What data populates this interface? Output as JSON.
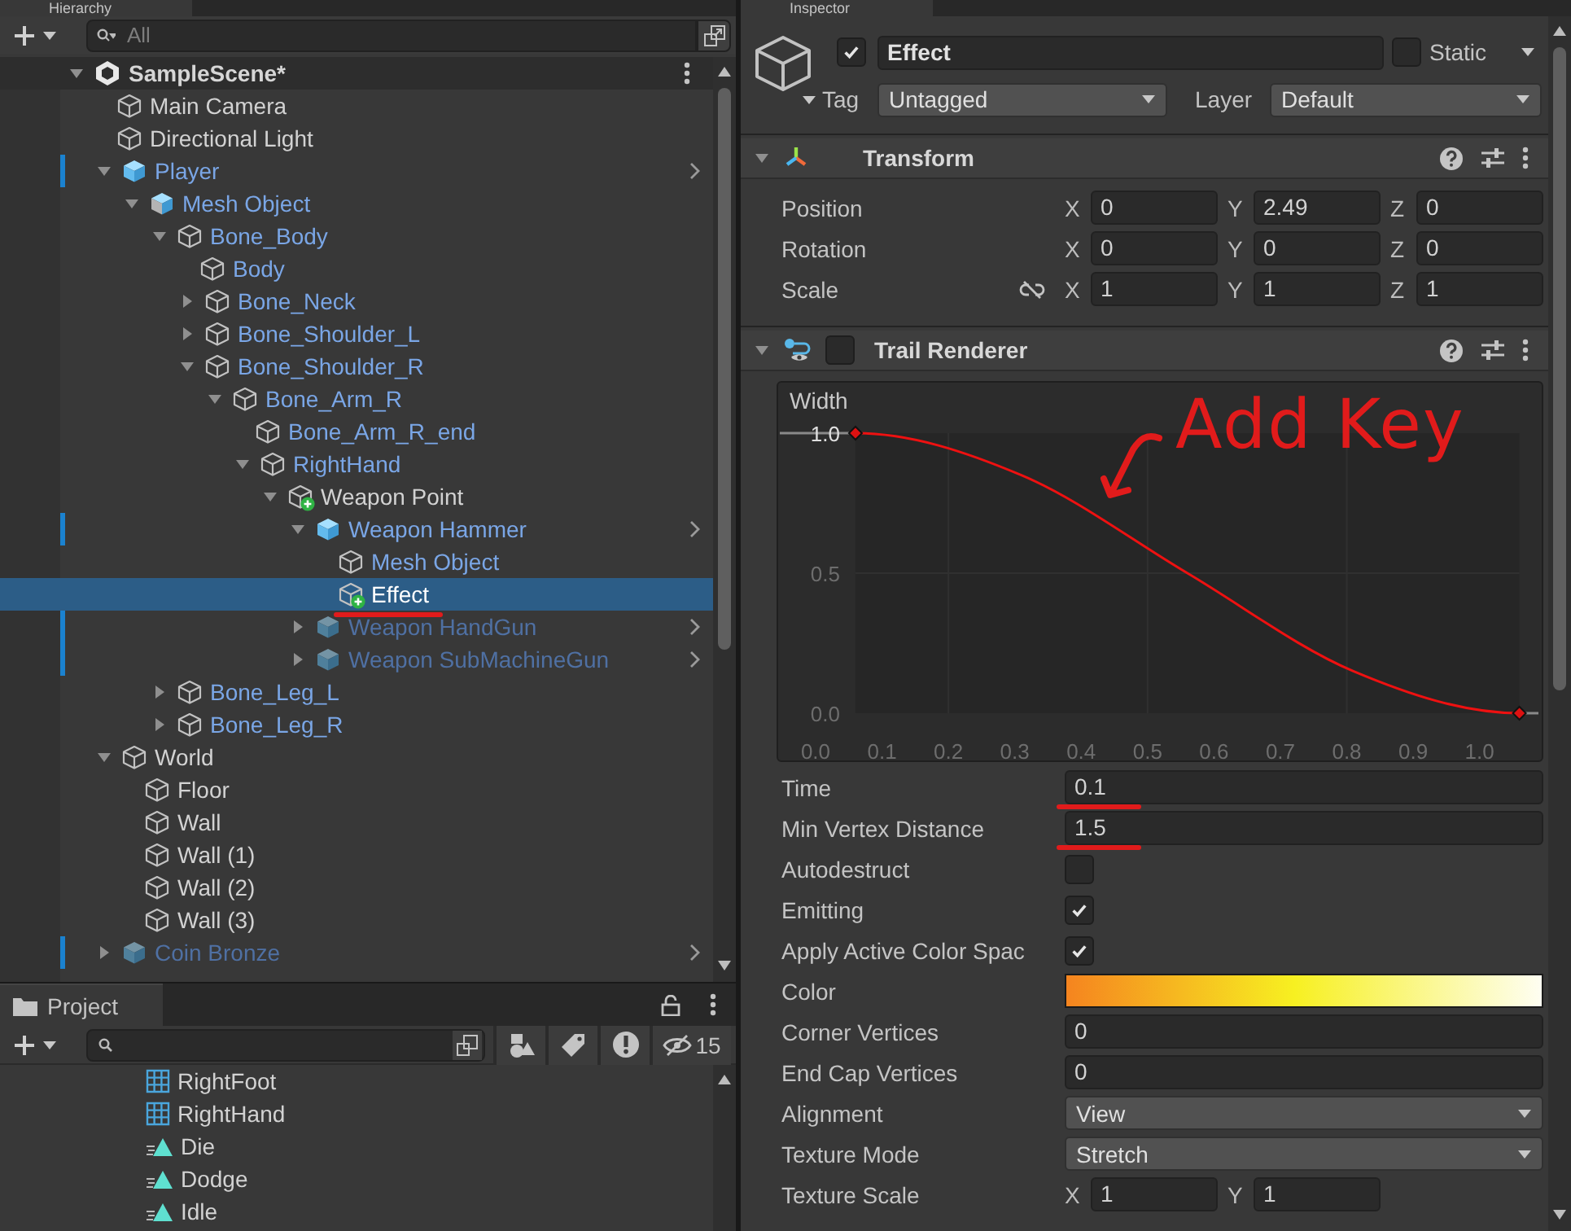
{
  "hierarchy": {
    "tab": "Hierarchy",
    "search": {
      "placeholder": "All"
    },
    "scene": {
      "name": "SampleScene*",
      "expanded": true
    },
    "items": [
      {
        "name": "Main Camera",
        "kind": "object",
        "added": false,
        "inactive": false,
        "selected": false,
        "marked": false
      },
      {
        "name": "Directional Light",
        "kind": "object",
        "added": false,
        "inactive": false,
        "selected": false,
        "marked": false
      },
      {
        "name": "Player",
        "kind": "prefab-root",
        "added": false,
        "inactive": false,
        "selected": false,
        "marked": false,
        "expanded": true,
        "children": [
          {
            "name": "Mesh Object",
            "kind": "model",
            "added": false,
            "inactive": false,
            "selected": false,
            "marked": false,
            "expanded": true,
            "children": [
              {
                "name": "Bone_Body",
                "kind": "prefab-child",
                "added": false,
                "inactive": false,
                "selected": false,
                "marked": false,
                "expanded": true,
                "children": [
                  {
                    "name": "Body",
                    "kind": "prefab-child",
                    "added": false,
                    "inactive": false,
                    "selected": false,
                    "marked": false
                  },
                  {
                    "name": "Bone_Neck",
                    "kind": "prefab-child",
                    "added": false,
                    "inactive": false,
                    "selected": false,
                    "marked": false,
                    "expanded": false
                  },
                  {
                    "name": "Bone_Shoulder_L",
                    "kind": "prefab-child",
                    "added": false,
                    "inactive": false,
                    "selected": false,
                    "marked": false,
                    "expanded": false
                  },
                  {
                    "name": "Bone_Shoulder_R",
                    "kind": "prefab-child",
                    "added": false,
                    "inactive": false,
                    "selected": false,
                    "marked": false,
                    "expanded": true,
                    "children": [
                      {
                        "name": "Bone_Arm_R",
                        "kind": "prefab-child",
                        "added": false,
                        "inactive": false,
                        "selected": false,
                        "marked": false,
                        "expanded": true,
                        "children": [
                          {
                            "name": "Bone_Arm_R_end",
                            "kind": "prefab-child",
                            "added": false,
                            "inactive": false,
                            "selected": false,
                            "marked": false
                          },
                          {
                            "name": "RightHand",
                            "kind": "prefab-child",
                            "added": false,
                            "inactive": false,
                            "selected": false,
                            "marked": false,
                            "expanded": true,
                            "children": [
                              {
                                "name": "Weapon Point",
                                "kind": "object",
                                "added": true,
                                "inactive": false,
                                "selected": false,
                                "marked": false,
                                "expanded": true,
                                "children": [
                                  {
                                    "name": "Weapon Hammer",
                                    "kind": "prefab-root",
                                    "added": false,
                                    "inactive": false,
                                    "selected": false,
                                    "marked": false,
                                    "expanded": true,
                                    "children": [
                                      {
                                        "name": "Mesh Object",
                                        "kind": "prefab-child",
                                        "added": false,
                                        "inactive": false,
                                        "selected": false,
                                        "marked": false
                                      },
                                      {
                                        "name": "Effect",
                                        "kind": "object",
                                        "added": true,
                                        "inactive": false,
                                        "selected": true,
                                        "marked": true
                                      }
                                    ]
                                  },
                                  {
                                    "name": "Weapon HandGun",
                                    "kind": "prefab-root",
                                    "added": false,
                                    "inactive": true,
                                    "selected": false,
                                    "marked": false,
                                    "expanded": false
                                  },
                                  {
                                    "name": "Weapon SubMachineGun",
                                    "kind": "prefab-root",
                                    "added": false,
                                    "inactive": true,
                                    "selected": false,
                                    "marked": false,
                                    "expanded": false
                                  }
                                ]
                              }
                            ]
                          }
                        ]
                      }
                    ]
                  }
                ]
              },
              {
                "name": "Bone_Leg_L",
                "kind": "prefab-child",
                "added": false,
                "inactive": false,
                "selected": false,
                "marked": false,
                "expanded": false
              },
              {
                "name": "Bone_Leg_R",
                "kind": "prefab-child",
                "added": false,
                "inactive": false,
                "selected": false,
                "marked": false,
                "expanded": false
              }
            ]
          }
        ]
      },
      {
        "name": "World",
        "kind": "object",
        "added": false,
        "inactive": false,
        "selected": false,
        "marked": false,
        "expanded": true,
        "children": [
          {
            "name": "Floor",
            "kind": "object",
            "added": false,
            "inactive": false,
            "selected": false,
            "marked": false
          },
          {
            "name": "Wall",
            "kind": "object",
            "added": false,
            "inactive": false,
            "selected": false,
            "marked": false
          },
          {
            "name": "Wall (1)",
            "kind": "object",
            "added": false,
            "inactive": false,
            "selected": false,
            "marked": false
          },
          {
            "name": "Wall (2)",
            "kind": "object",
            "added": false,
            "inactive": false,
            "selected": false,
            "marked": false
          },
          {
            "name": "Wall (3)",
            "kind": "object",
            "added": false,
            "inactive": false,
            "selected": false,
            "marked": false
          }
        ]
      },
      {
        "name": "Coin Bronze",
        "kind": "prefab-root",
        "added": false,
        "inactive": true,
        "selected": false,
        "marked": false,
        "expanded": false
      }
    ]
  },
  "project": {
    "tab": "Project",
    "hidden_count": "15",
    "items": [
      {
        "name": "RightFoot",
        "kind": "mask"
      },
      {
        "name": "RightHand",
        "kind": "mask"
      },
      {
        "name": "Die",
        "kind": "clip"
      },
      {
        "name": "Dodge",
        "kind": "clip"
      },
      {
        "name": "Idle",
        "kind": "clip"
      }
    ]
  },
  "inspector": {
    "tab": "Inspector",
    "object": {
      "active": true,
      "name": "Effect",
      "static": false,
      "static_label": "Static",
      "tag_label": "Tag",
      "tag": "Untagged",
      "layer_label": "Layer",
      "layer": "Default"
    },
    "components": [
      {
        "kind": "transform",
        "title": "Transform",
        "expanded": true,
        "rows": [
          {
            "label": "Position",
            "fields": [
              {
                "axis": "X",
                "value": "0"
              },
              {
                "axis": "Y",
                "value": "2.49"
              },
              {
                "axis": "Z",
                "value": "0"
              }
            ]
          },
          {
            "label": "Rotation",
            "fields": [
              {
                "axis": "X",
                "value": "0"
              },
              {
                "axis": "Y",
                "value": "0"
              },
              {
                "axis": "Z",
                "value": "0"
              }
            ]
          },
          {
            "label": "Scale",
            "constrained": false,
            "fields": [
              {
                "axis": "X",
                "value": "1"
              },
              {
                "axis": "Y",
                "value": "1"
              },
              {
                "axis": "Z",
                "value": "1"
              }
            ]
          }
        ]
      },
      {
        "kind": "trail",
        "title": "Trail Renderer",
        "expanded": true,
        "enabled": false,
        "curve": {
          "chart_data": {
            "type": "line",
            "title": "Width",
            "x": [
              0.06,
              0.31,
              0.56,
              0.81,
              1.06
            ],
            "values": [
              1,
              0.85,
              0.5,
              0.15,
              0
            ],
            "xlim": [
              0,
              1.06
            ],
            "ylim": [
              0,
              1
            ],
            "grid": true,
            "xticks": [
              {
                "value": 0,
                "label": "0.0"
              },
              {
                "value": 0.1,
                "label": "0.1"
              },
              {
                "value": 0.2,
                "label": "0.2"
              },
              {
                "value": 0.3,
                "label": "0.3"
              },
              {
                "value": 0.4,
                "label": "0.4"
              },
              {
                "value": 0.5,
                "label": "0.5"
              },
              {
                "value": 0.6,
                "label": "0.6"
              },
              {
                "value": 0.7,
                "label": "0.7"
              },
              {
                "value": 0.8,
                "label": "0.8"
              },
              {
                "value": 0.9,
                "label": "0.9"
              },
              {
                "value": 1,
                "label": "1.0"
              }
            ],
            "yticks": [
              {
                "value": 0,
                "label": "0.0"
              },
              {
                "value": 0.5,
                "label": "0.5"
              },
              {
                "value": 1,
                "label": "1.0"
              }
            ],
            "annotations": [
              {
                "text": "Add Key"
              }
            ]
          }
        },
        "properties": [
          {
            "kind": "number",
            "label": "Time",
            "value": "0.1",
            "marked": true
          },
          {
            "kind": "number",
            "label": "Min Vertex Distance",
            "value": "1.5",
            "marked": true
          },
          {
            "kind": "toggle",
            "label": "Autodestruct",
            "checked": false
          },
          {
            "kind": "toggle",
            "label": "Emitting",
            "checked": true
          },
          {
            "kind": "toggle",
            "label": "Apply Active Color Spac",
            "checked": true
          },
          {
            "kind": "gradient",
            "label": "Color"
          },
          {
            "kind": "number",
            "label": "Corner Vertices",
            "value": "0",
            "marked": false
          },
          {
            "kind": "number",
            "label": "End Cap Vertices",
            "value": "0",
            "marked": false
          },
          {
            "kind": "dropdown",
            "label": "Alignment",
            "value": "View"
          },
          {
            "kind": "dropdown",
            "label": "Texture Mode",
            "value": "Stretch"
          },
          {
            "kind": "vector",
            "label": "Texture Scale",
            "fields": [
              {
                "axis": "X",
                "value": "1"
              },
              {
                "axis": "Y",
                "value": "1"
              }
            ]
          }
        ]
      }
    ]
  }
}
